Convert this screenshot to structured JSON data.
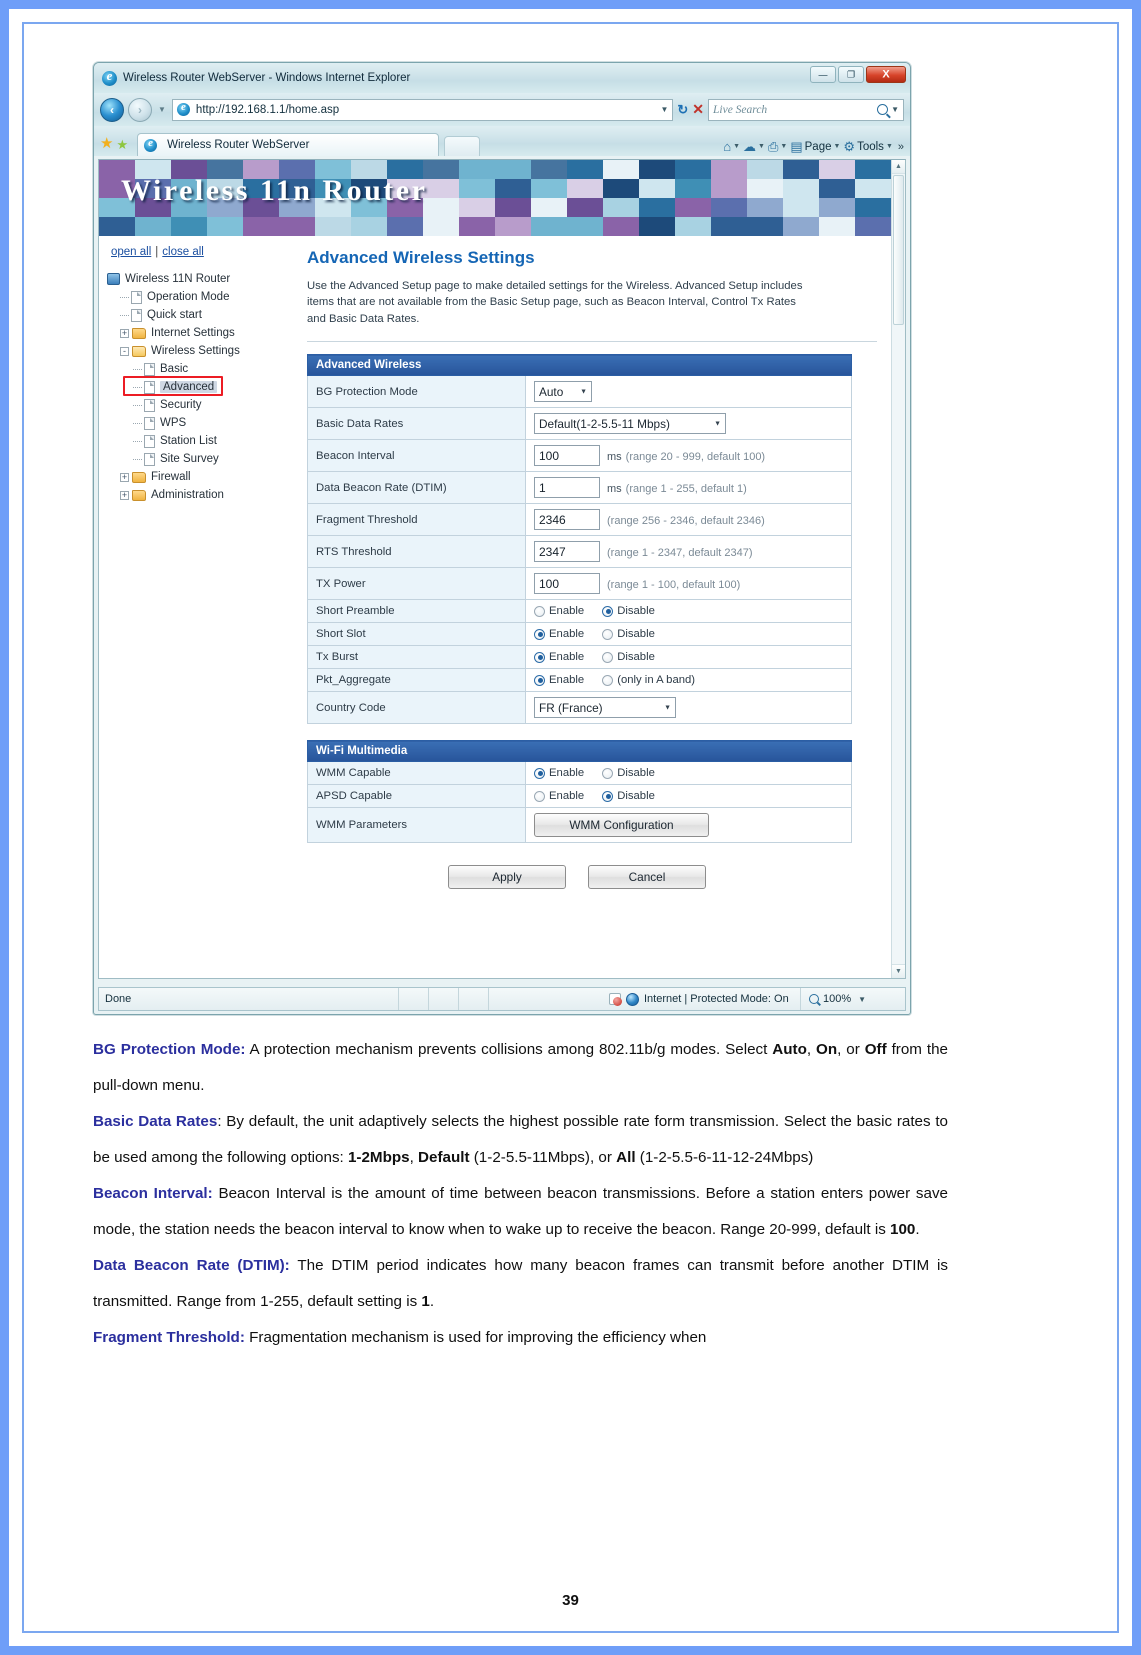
{
  "browser": {
    "window_title": "Wireless Router WebServer - Windows Internet Explorer",
    "url": "http://192.168.1.1/home.asp",
    "search_placeholder": "Live Search",
    "tab_label": "Wireless Router WebServer",
    "commands": {
      "page": "Page",
      "tools": "Tools",
      "overflow": "»"
    },
    "window_buttons": {
      "minimize": "—",
      "maximize": "❐",
      "close": "X"
    },
    "status": {
      "done": "Done",
      "zone": "Internet | Protected Mode: On",
      "zoom": "100%"
    }
  },
  "router_page": {
    "banner_title": "Wireless 11n Router",
    "tree_actions": {
      "open_all": "open all",
      "close_all": "close all",
      "separator": "|"
    },
    "tree": [
      {
        "label": "Wireless 11N Router",
        "icon": "computer-icon",
        "level": 0,
        "toggle": "none"
      },
      {
        "label": "Operation Mode",
        "icon": "page-icon",
        "level": 1,
        "toggle": "none"
      },
      {
        "label": "Quick start",
        "icon": "page-icon",
        "level": 1,
        "toggle": "none"
      },
      {
        "label": "Internet Settings",
        "icon": "folder-icon",
        "level": 1,
        "toggle": "+"
      },
      {
        "label": "Wireless Settings",
        "icon": "folder-open-icon",
        "level": 1,
        "toggle": "-"
      },
      {
        "label": "Basic",
        "icon": "page-icon",
        "level": 2,
        "toggle": "none"
      },
      {
        "label": "Advanced",
        "icon": "page-icon",
        "level": 2,
        "toggle": "none",
        "selected": true
      },
      {
        "label": "Security",
        "icon": "page-icon",
        "level": 2,
        "toggle": "none"
      },
      {
        "label": "WPS",
        "icon": "page-icon",
        "level": 2,
        "toggle": "none"
      },
      {
        "label": "Station List",
        "icon": "page-icon",
        "level": 2,
        "toggle": "none"
      },
      {
        "label": "Site Survey",
        "icon": "page-icon",
        "level": 2,
        "toggle": "none"
      },
      {
        "label": "Firewall",
        "icon": "folder-icon",
        "level": 1,
        "toggle": "+"
      },
      {
        "label": "Administration",
        "icon": "folder-icon",
        "level": 1,
        "toggle": "+"
      }
    ],
    "heading": "Advanced Wireless Settings",
    "description": "Use the Advanced Setup page to make detailed settings for the Wireless. Advanced Setup includes items that are not available from the Basic Setup page, such as Beacon Interval, Control Tx Rates and Basic Data Rates.",
    "advanced_wireless": {
      "section_title": "Advanced Wireless",
      "rows": [
        {
          "label": "BG Protection Mode",
          "type": "select",
          "value": "Auto"
        },
        {
          "label": "Basic Data Rates",
          "type": "select",
          "value": "Default(1-2-5.5-11 Mbps)"
        },
        {
          "label": "Beacon Interval",
          "type": "text",
          "value": "100",
          "unit": "ms",
          "hint": "(range 20 - 999, default 100)"
        },
        {
          "label": "Data Beacon Rate (DTIM)",
          "type": "text",
          "value": "1",
          "unit": "ms",
          "hint": "(range 1 - 255, default 1)"
        },
        {
          "label": "Fragment Threshold",
          "type": "text",
          "value": "2346",
          "unit": "",
          "hint": "(range 256 - 2346, default 2346)"
        },
        {
          "label": "RTS Threshold",
          "type": "text",
          "value": "2347",
          "unit": "",
          "hint": "(range 1 - 2347, default 2347)"
        },
        {
          "label": "TX Power",
          "type": "text",
          "value": "100",
          "unit": "",
          "hint": "(range 1 - 100, default 100)"
        },
        {
          "label": "Short Preamble",
          "type": "radio",
          "options": [
            "Enable",
            "Disable"
          ],
          "selected": 1
        },
        {
          "label": "Short Slot",
          "type": "radio",
          "options": [
            "Enable",
            "Disable"
          ],
          "selected": 0
        },
        {
          "label": "Tx Burst",
          "type": "radio",
          "options": [
            "Enable",
            "Disable"
          ],
          "selected": 0
        },
        {
          "label": "Pkt_Aggregate",
          "type": "radio",
          "options": [
            "Enable",
            "(only in A band)"
          ],
          "selected": 0
        },
        {
          "label": "Country Code",
          "type": "select",
          "value": "FR (France)"
        }
      ]
    },
    "wifi_multimedia": {
      "section_title": "Wi-Fi Multimedia",
      "rows": [
        {
          "label": "WMM Capable",
          "type": "radio",
          "options": [
            "Enable",
            "Disable"
          ],
          "selected": 0
        },
        {
          "label": "APSD Capable",
          "type": "radio",
          "options": [
            "Enable",
            "Disable"
          ],
          "selected": 1
        },
        {
          "label": "WMM Parameters",
          "type": "button",
          "value": "WMM Configuration"
        }
      ]
    },
    "actions": {
      "apply": "Apply",
      "cancel": "Cancel"
    }
  },
  "manual": {
    "paragraphs": [
      {
        "term": "BG Protection Mode:",
        "html": " A protection mechanism prevents collisions among 802.11b/g modes. Select <b>Auto</b>, <b>On</b>, or <b>Off</b> from the pull-down menu."
      },
      {
        "term": "Basic Data Rates",
        "html": ": By default, the unit adaptively selects the highest possible rate form transmission. Select the basic rates to be used among the following options: <b>1-2Mbps</b>, <b>Default</b> (1-2-5.5-11Mbps), or <b>All</b> (1-2-5.5-6-11-12-24Mbps)"
      },
      {
        "term": "Beacon Interval:",
        "html": " Beacon Interval is the amount of time between beacon transmissions. Before a station enters power save mode, the station needs the beacon interval to know when to wake up to receive the beacon. Range 20-999, default is <b>100</b>."
      },
      {
        "term": "Data Beacon Rate (DTIM):",
        "html": " The DTIM period indicates how many beacon frames can transmit before another DTIM is transmitted. Range from 1-255, default setting is <b>1</b>."
      },
      {
        "term": "Fragment Threshold:",
        "html": " Fragmentation mechanism is used for improving the efficiency when"
      }
    ],
    "page_number": "39"
  },
  "colors": {
    "page_border": "#6f9ef8",
    "term_blue": "#2b2f9e",
    "heading_blue": "#1566b5",
    "table_header": "#27549a",
    "highlight_red": "#ec1c24"
  }
}
